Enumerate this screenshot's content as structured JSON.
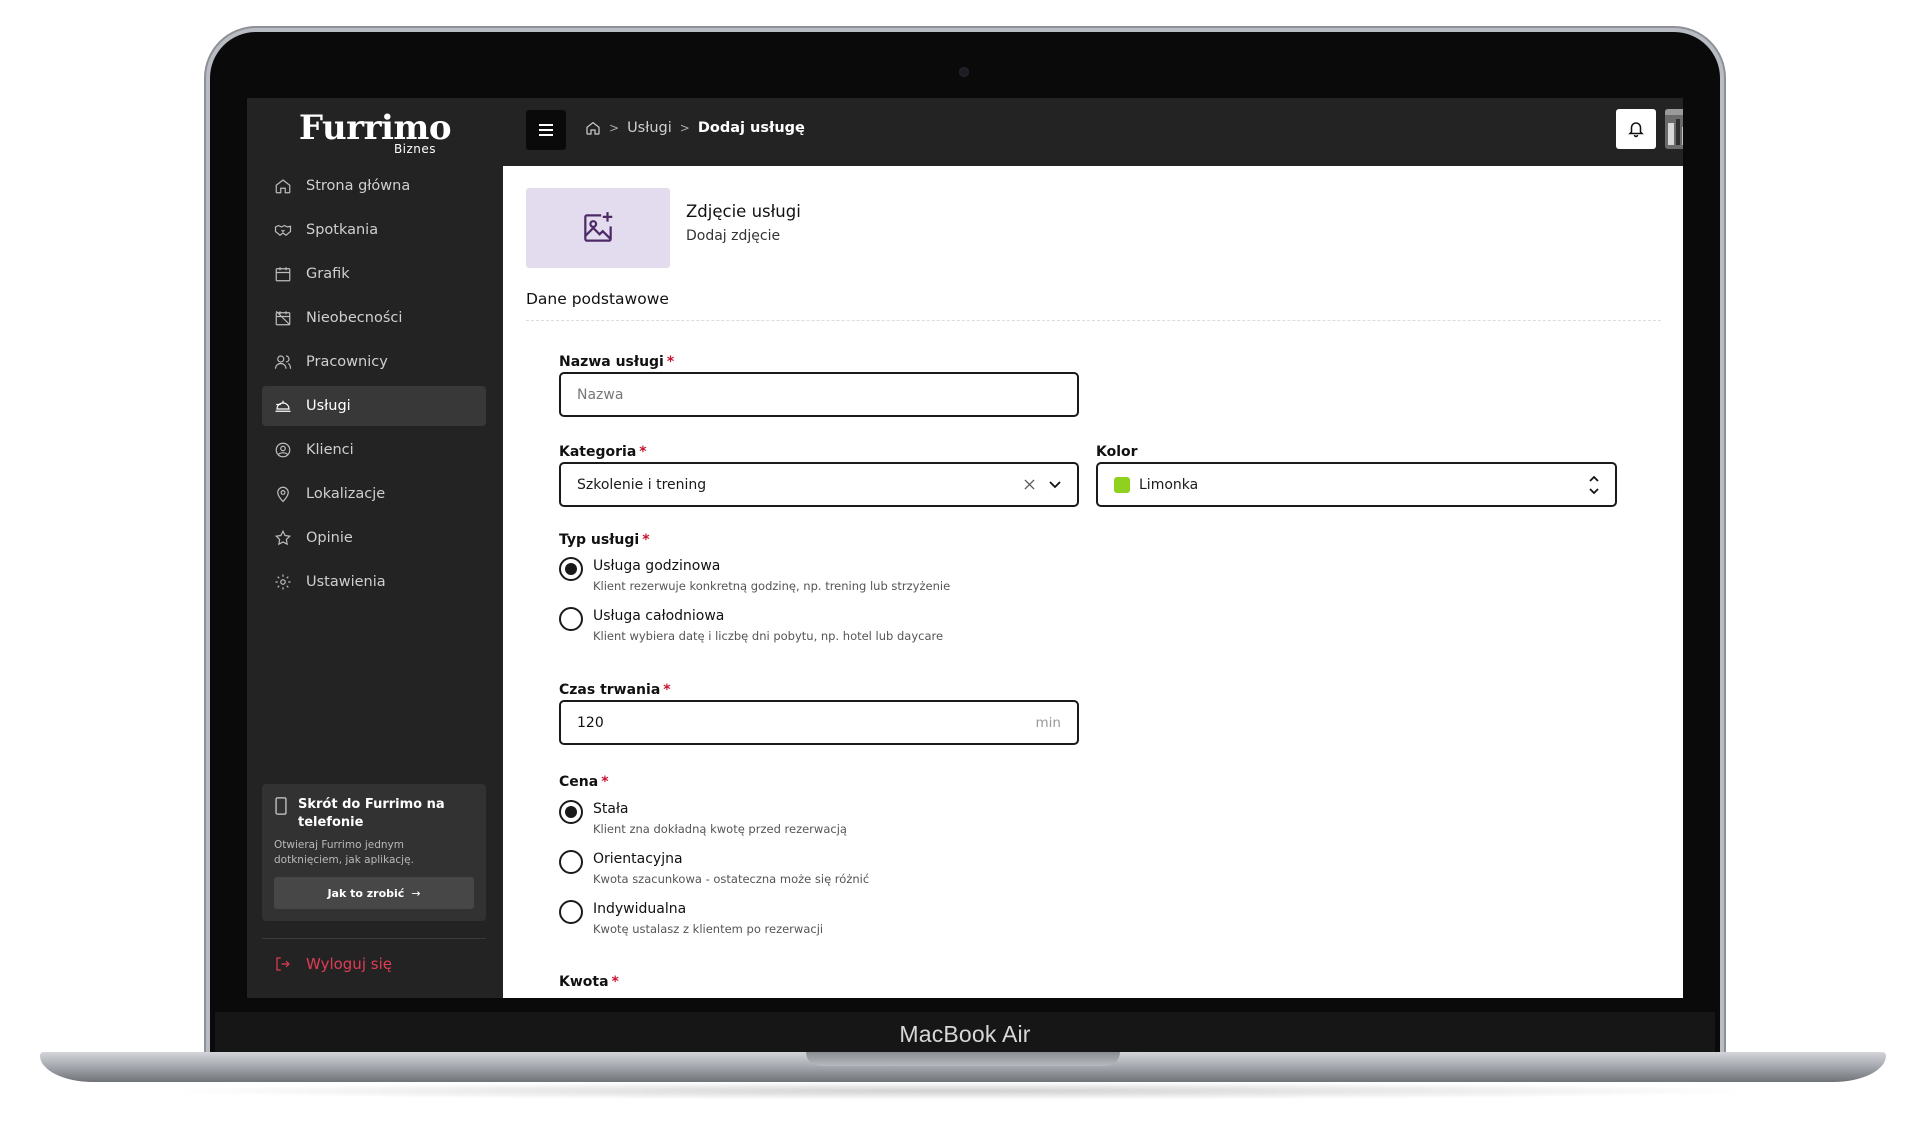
{
  "device": {
    "label": "MacBook Air"
  },
  "sidebar": {
    "logo": "Furrimo",
    "logo_sub": "Biznes",
    "items": [
      {
        "label": "Strona główna",
        "icon": "home-icon"
      },
      {
        "label": "Spotkania",
        "icon": "handshake-icon"
      },
      {
        "label": "Grafik",
        "icon": "calendar-icon"
      },
      {
        "label": "Nieobecności",
        "icon": "calendar-off-icon"
      },
      {
        "label": "Pracownicy",
        "icon": "users-icon"
      },
      {
        "label": "Usługi",
        "icon": "service-icon",
        "active": true
      },
      {
        "label": "Klienci",
        "icon": "user-circle-icon"
      },
      {
        "label": "Lokalizacje",
        "icon": "map-pin-icon"
      },
      {
        "label": "Opinie",
        "icon": "star-icon"
      },
      {
        "label": "Ustawienia",
        "icon": "gear-icon"
      }
    ],
    "promo": {
      "title": "Skrót do Furrimo na telefonie",
      "description": "Otwieraj Furrimo jednym dotknięciem, jak aplikację.",
      "button_label": "Jak to zrobić"
    },
    "logout_label": "Wyloguj się"
  },
  "topbar": {
    "breadcrumb": {
      "parent": "Usługi",
      "current": "Dodaj usługę"
    }
  },
  "photo": {
    "title": "Zdjęcie usługi",
    "subtitle": "Dodaj zdjęcie"
  },
  "section_title": "Dane podstawowe",
  "form": {
    "name": {
      "label": "Nazwa usługi",
      "placeholder": "Nazwa",
      "value": ""
    },
    "category": {
      "label": "Kategoria",
      "value": "Szkolenie i trening"
    },
    "color": {
      "label": "Kolor",
      "value": "Limonka",
      "swatch": "#8fd11e"
    },
    "service_type": {
      "label": "Typ usługi",
      "options": [
        {
          "title": "Usługa godzinowa",
          "desc": "Klient rezerwuje konkretną godzinę, np. trening lub strzyżenie",
          "checked": true
        },
        {
          "title": "Usługa całodniowa",
          "desc": "Klient wybiera datę i liczbę dni pobytu, np. hotel lub daycare",
          "checked": false
        }
      ]
    },
    "duration": {
      "label": "Czas trwania",
      "value": "120",
      "unit": "min"
    },
    "price": {
      "label": "Cena",
      "options": [
        {
          "title": "Stała",
          "desc": "Klient zna dokładną kwotę przed rezerwacją",
          "checked": true
        },
        {
          "title": "Orientacyjna",
          "desc": "Kwota szacunkowa - ostateczna może się różnić",
          "checked": false
        },
        {
          "title": "Indywidualna",
          "desc": "Kwotę ustalasz z klientem po rezerwacji",
          "checked": false
        }
      ]
    },
    "amount": {
      "label": "Kwota"
    },
    "required_mark": "*"
  }
}
